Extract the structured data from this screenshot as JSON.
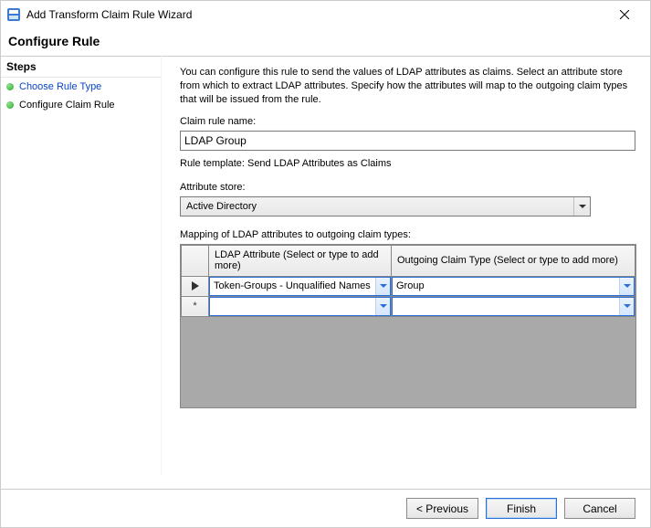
{
  "window": {
    "title": "Add Transform Claim Rule Wizard"
  },
  "header": "Configure Rule",
  "sidebar": {
    "steps_header": "Steps",
    "items": [
      {
        "label": "Choose Rule Type"
      },
      {
        "label": "Configure Claim Rule"
      }
    ]
  },
  "main": {
    "description": "You can configure this rule to send the values of LDAP attributes as claims. Select an attribute store from which to extract LDAP attributes. Specify how the attributes will map to the outgoing claim types that will be issued from the rule.",
    "claim_rule_name_label": "Claim rule name:",
    "claim_rule_name_value": "LDAP Group",
    "rule_template_text": "Rule template: Send LDAP Attributes as Claims",
    "attribute_store_label": "Attribute store:",
    "attribute_store_value": "Active Directory",
    "mapping_label": "Mapping of LDAP attributes to outgoing claim types:",
    "grid": {
      "col1_header": "LDAP Attribute (Select or type to add more)",
      "col2_header": "Outgoing Claim Type (Select or type to add more)",
      "rows": [
        {
          "attr": "Token-Groups - Unqualified Names",
          "claim": "Group"
        },
        {
          "attr": "",
          "claim": ""
        }
      ]
    }
  },
  "footer": {
    "previous": "< Previous",
    "finish": "Finish",
    "cancel": "Cancel"
  }
}
